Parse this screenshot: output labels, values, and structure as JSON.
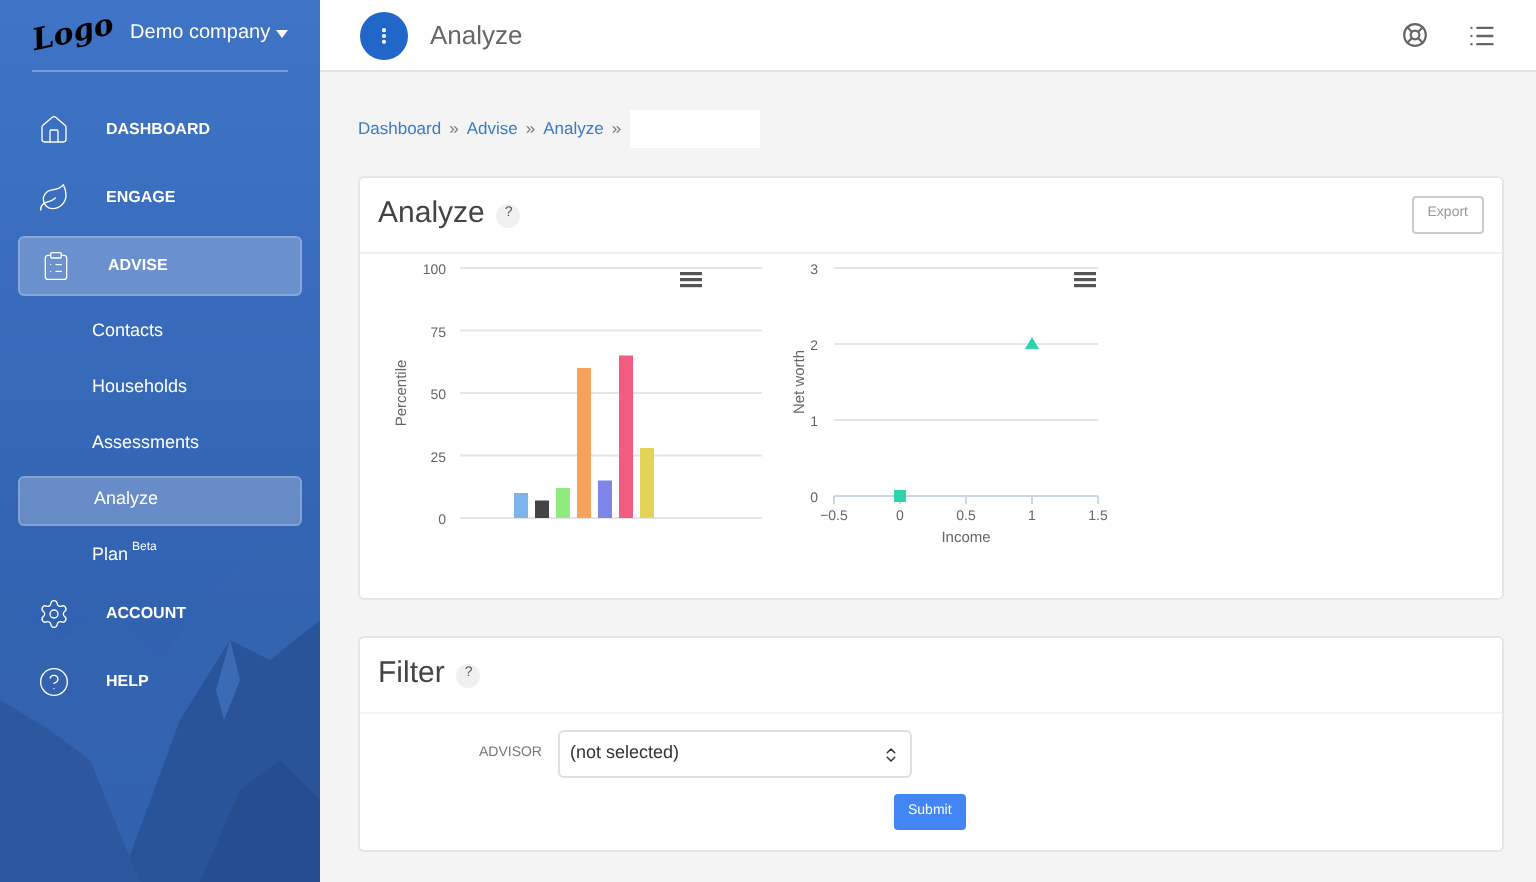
{
  "sidebar": {
    "logo": "Logo",
    "company": "Demo company",
    "items": [
      {
        "label": "DASHBOARD",
        "selected": false
      },
      {
        "label": "ENGAGE",
        "selected": false
      },
      {
        "label": "ADVISE",
        "selected": true,
        "children": [
          {
            "label": "Contacts",
            "selected": false
          },
          {
            "label": "Households",
            "selected": false
          },
          {
            "label": "Assessments",
            "selected": false
          },
          {
            "label": "Analyze",
            "selected": true
          },
          {
            "label": "Plan",
            "sup": "Beta",
            "selected": false
          }
        ]
      },
      {
        "label": "ACCOUNT",
        "selected": false
      },
      {
        "label": "HELP",
        "selected": false
      }
    ]
  },
  "header": {
    "title": "Analyze"
  },
  "breadcrumb": {
    "separator": "»",
    "items": [
      "Dashboard",
      "Advise",
      "Analyze"
    ]
  },
  "analyze_card": {
    "title": "Analyze",
    "help": "?",
    "export": "Export",
    "charts": [
      {
        "chart_data": {
          "type": "bar",
          "grid": true,
          "ylabel": "Percentile",
          "yticks": [
            0,
            25,
            50,
            75,
            100
          ],
          "ylim": [
            0,
            100
          ],
          "series": [
            {
              "color": "#7cb5ec",
              "values": [
                10
              ]
            },
            {
              "color": "#434348",
              "values": [
                7
              ]
            },
            {
              "color": "#90ed7d",
              "values": [
                12
              ]
            },
            {
              "color": "#f7a35c",
              "values": [
                60
              ]
            },
            {
              "color": "#8085e9",
              "values": [
                15
              ]
            },
            {
              "color": "#f15c80",
              "values": [
                65
              ]
            },
            {
              "color": "#e4d354",
              "values": [
                28
              ]
            }
          ]
        }
      },
      {
        "chart_data": {
          "type": "scatter",
          "grid": true,
          "xlabel": "Income",
          "ylabel": "Net worth",
          "xlim": [
            -0.5,
            1.5
          ],
          "ylim": [
            0,
            3
          ],
          "xticks": [
            {
              "value": -0.5,
              "label": "−0.5"
            },
            {
              "value": 0,
              "label": "0"
            },
            {
              "value": 0.5,
              "label": "0.5"
            },
            {
              "value": 1,
              "label": "1"
            },
            {
              "value": 1.5,
              "label": "1.5"
            }
          ],
          "yticks": [
            0,
            1,
            2,
            3
          ],
          "series": [
            {
              "color": "#2bd4a9",
              "marker": "square",
              "x": [
                0
              ],
              "values": [
                0
              ]
            },
            {
              "color": "#2bd4a9",
              "marker": "triangle",
              "x": [
                1
              ],
              "values": [
                2
              ]
            }
          ]
        }
      }
    ]
  },
  "filter_card": {
    "title": "Filter",
    "help": "?",
    "field_label": "ADVISOR",
    "select_value": "(not selected)",
    "submit": "Submit"
  }
}
